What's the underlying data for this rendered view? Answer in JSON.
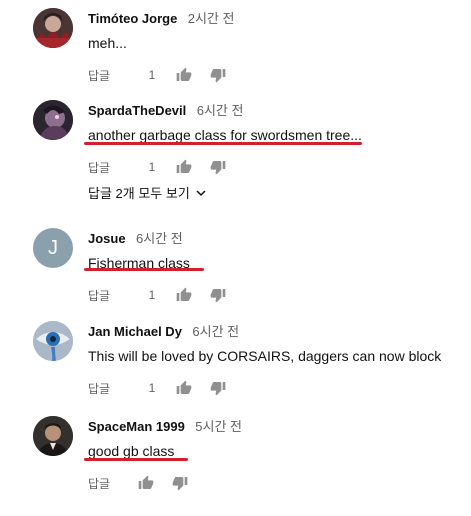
{
  "comments": [
    {
      "author": "Timóteo Jorge",
      "time": "2시간 전",
      "text": "meh...",
      "reply_label": "답글",
      "likes": "1",
      "avatar_icon": "dark-character-avatar-icon"
    },
    {
      "author": "SpardaTheDevil",
      "time": "6시간 전",
      "text": "another garbage class for swordsmen tree...",
      "reply_label": "답글",
      "likes": "1",
      "avatar_icon": "purple-character-avatar-icon"
    },
    {
      "author": "Josue",
      "time": "6시간 전",
      "text": "Fisherman class",
      "reply_label": "답글",
      "likes": "1",
      "avatar_letter": "J",
      "avatar_color": "#8aa0ad"
    },
    {
      "author": "Jan Michael Dy",
      "time": "6시간 전",
      "text": "This will be loved by CORSAIRS, daggers can now block",
      "reply_label": "답글",
      "likes": "1",
      "avatar_icon": "blue-eye-avatar-icon"
    },
    {
      "author": "SpaceMan 1999",
      "time": "5시간 전",
      "text": "good gb class",
      "reply_label": "답글",
      "likes": "",
      "avatar_icon": "man-portrait-avatar-icon"
    }
  ],
  "view_replies": "답글 2개 모두 보기",
  "highlight_color": "#d61f2c"
}
